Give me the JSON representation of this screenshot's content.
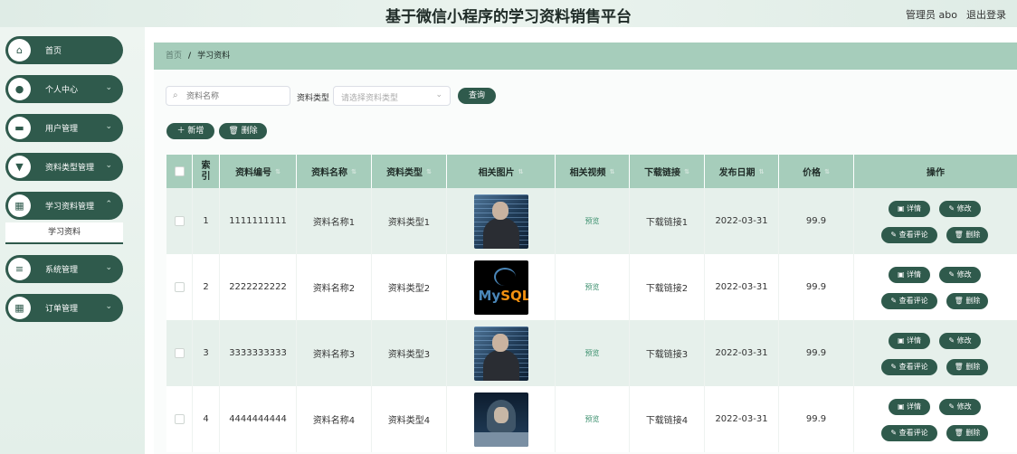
{
  "header": {
    "title": "基于微信小程序的学习资料销售平台",
    "user": "管理员 abo",
    "logout": "退出登录"
  },
  "sidebar": {
    "items": [
      {
        "label": "首页",
        "icon": "home-icon",
        "has_chevron": false
      },
      {
        "label": "个人中心",
        "icon": "person-icon",
        "has_chevron": true
      },
      {
        "label": "用户管理",
        "icon": "users-icon",
        "has_chevron": true
      },
      {
        "label": "资料类型管理",
        "icon": "tag-icon",
        "has_chevron": true
      },
      {
        "label": "学习资料管理",
        "icon": "grid-icon",
        "has_chevron": true
      },
      {
        "label": "系统管理",
        "icon": "list-icon",
        "has_chevron": true
      },
      {
        "label": "订单管理",
        "icon": "grid-icon",
        "has_chevron": true
      }
    ],
    "submenu_active": "学习资料"
  },
  "breadcrumb": {
    "home": "首页",
    "separator": "/",
    "current": "学习资料"
  },
  "search": {
    "name_placeholder": "资料名称",
    "type_label": "资料类型",
    "type_placeholder": "请选择资料类型",
    "query_button": "查询"
  },
  "actions": {
    "add": "＋ 新增",
    "delete": "🗑 删除"
  },
  "table": {
    "headers": [
      "索引",
      "资料编号",
      "资料名称",
      "资料类型",
      "相关图片",
      "相关视频",
      "下载链接",
      "发布日期",
      "价格",
      "操作"
    ],
    "rows": [
      {
        "index": "1",
        "code": "1111111111",
        "name": "资料名称1",
        "type": "资料类型1",
        "image": "person",
        "video": "预览",
        "link": "下载链接1",
        "date": "2022-03-31",
        "price": "99.9"
      },
      {
        "index": "2",
        "code": "2222222222",
        "name": "资料名称2",
        "type": "资料类型2",
        "image": "mysql",
        "video": "预览",
        "link": "下载链接2",
        "date": "2022-03-31",
        "price": "99.9"
      },
      {
        "index": "3",
        "code": "3333333333",
        "name": "资料名称3",
        "type": "资料类型3",
        "image": "person",
        "video": "预览",
        "link": "下载链接3",
        "date": "2022-03-31",
        "price": "99.9"
      },
      {
        "index": "4",
        "code": "4444444444",
        "name": "资料名称4",
        "type": "资料类型4",
        "image": "hacker",
        "video": "预览",
        "link": "下载链接4",
        "date": "2022-03-31",
        "price": "99.9"
      }
    ],
    "row_actions": {
      "detail": "详情",
      "edit": "修改",
      "comments": "查看评论",
      "delete": "删除"
    }
  },
  "mysql_logo": {
    "my": "My",
    "sql": "SQL"
  },
  "colors": {
    "primary": "#2f5a4c",
    "header_bg": "#a6cdbb",
    "row_alt": "#e6f0eb"
  }
}
